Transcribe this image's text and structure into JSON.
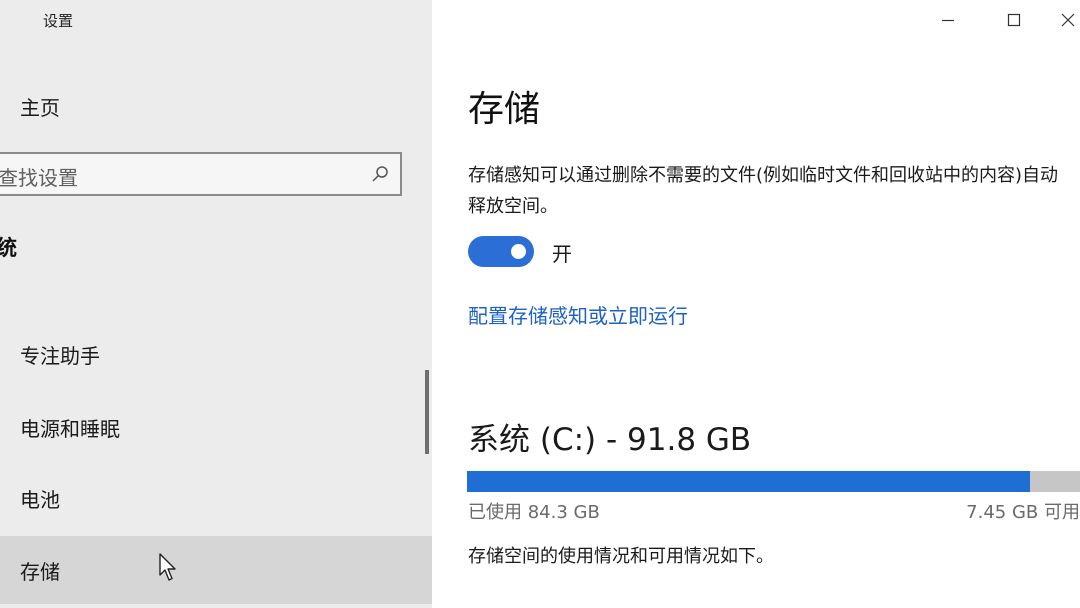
{
  "window": {
    "title": "设置",
    "controls": {
      "minimize": "minimize-icon",
      "maximize": "maximize-icon",
      "close": "close-icon"
    }
  },
  "sidebar": {
    "home_label": "主页",
    "search": {
      "placeholder": "查找设置"
    },
    "section_label": "统",
    "items": [
      {
        "label": "专注助手"
      },
      {
        "label": "电源和睡眠"
      },
      {
        "label": "电池"
      },
      {
        "label": "存储",
        "selected": true
      }
    ]
  },
  "main": {
    "title": "存储",
    "description": "存储感知可以通过删除不需要的文件(例如临时文件和回收站中的内容)自动释放空间。",
    "toggle": {
      "state": "开",
      "on": true
    },
    "config_link": "配置存储感知或立即运行",
    "drive": {
      "title": "系统 (C:) - 91.8 GB",
      "used_label": "已使用 84.3 GB",
      "free_label": "7.45 GB 可用",
      "used_fraction": 0.918
    },
    "usage_note": "存储空间的使用情况和可用情况如下。"
  },
  "colors": {
    "sidebar_bg": "#ececec",
    "accent": "#1f6ed4",
    "link": "#1d62c4",
    "bar_empty": "#c6c6c6"
  }
}
